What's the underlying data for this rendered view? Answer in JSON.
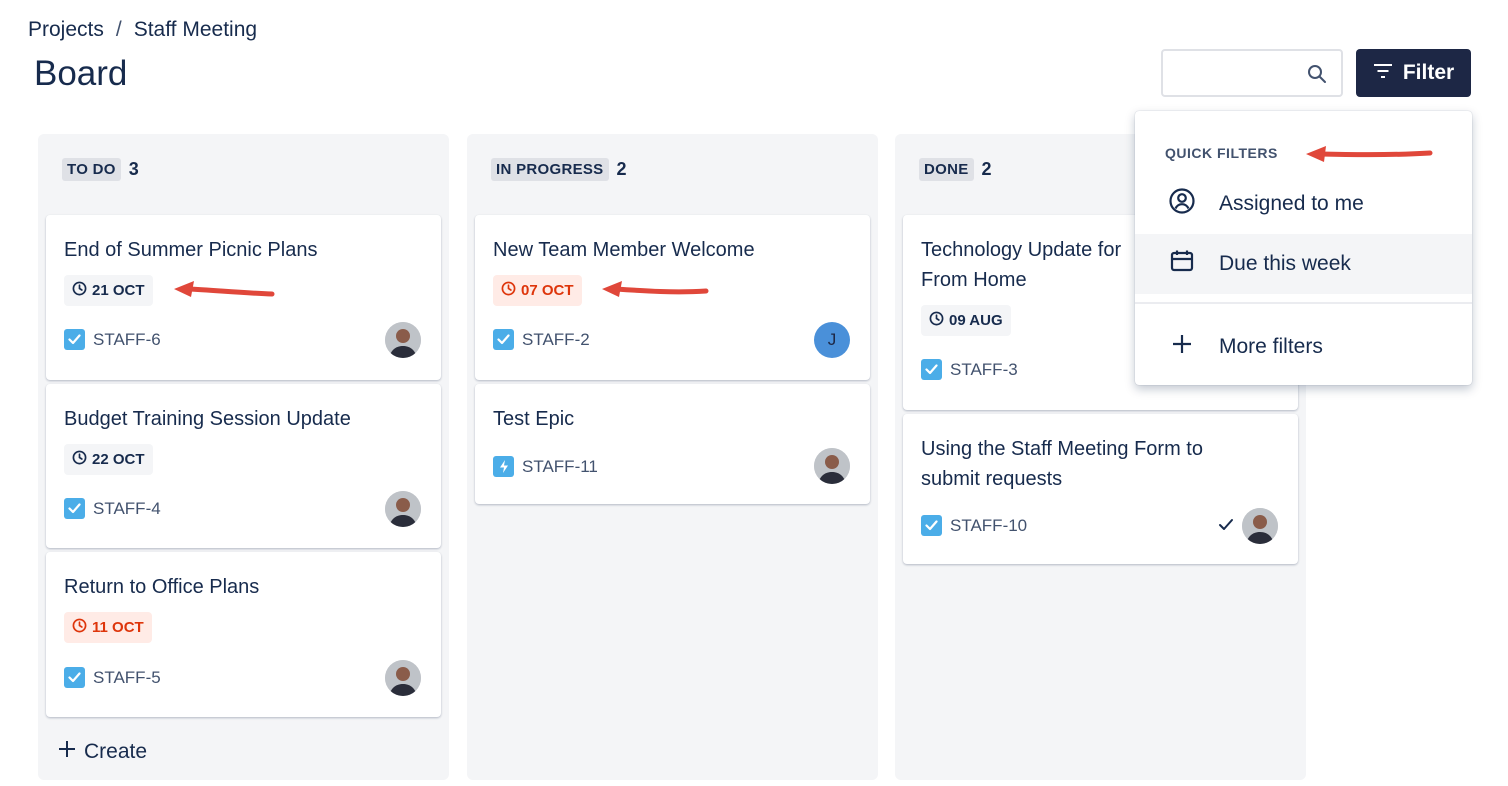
{
  "breadcrumb": {
    "items": [
      "Projects",
      "Staff Meeting"
    ],
    "separator": "/"
  },
  "page_title": "Board",
  "search": {
    "value": "",
    "placeholder": ""
  },
  "filter_button": {
    "label": "Filter"
  },
  "columns": [
    {
      "title": "TO DO",
      "count": "3",
      "create_label": "Create",
      "cards": [
        {
          "title": "End of Summer Picnic Plans",
          "date": "21 OCT",
          "date_status": "normal",
          "key": "STAFF-6",
          "type": "task",
          "assignee": "photo"
        },
        {
          "title": "Budget Training Session Update",
          "date": "22 OCT",
          "date_status": "normal",
          "key": "STAFF-4",
          "type": "task",
          "assignee": "photo"
        },
        {
          "title": "Return to Office Plans",
          "date": "11 OCT",
          "date_status": "overdue",
          "key": "STAFF-5",
          "type": "task",
          "assignee": "photo"
        }
      ]
    },
    {
      "title": "IN PROGRESS",
      "count": "2",
      "cards": [
        {
          "title": "New Team Member Welcome",
          "date": "07 OCT",
          "date_status": "overdue",
          "key": "STAFF-2",
          "type": "task",
          "assignee": "J"
        },
        {
          "title": "Test Epic",
          "key": "STAFF-11",
          "type": "epic",
          "assignee": "photo"
        }
      ]
    },
    {
      "title": "DONE",
      "count": "2",
      "cards": [
        {
          "title_line1": "Technology Update for",
          "title_line2": "From Home",
          "date": "09 AUG",
          "date_status": "normal",
          "key": "STAFF-3",
          "type": "task"
        },
        {
          "title_line1": "Using the Staff Meeting Form to",
          "title_line2": "submit requests",
          "key": "STAFF-10",
          "type": "task",
          "assignee": "photo",
          "done_check": true
        }
      ]
    }
  ],
  "quick_filters": {
    "heading": "QUICK FILTERS",
    "items": [
      {
        "label": "Assigned to me",
        "icon": "person-circle-icon"
      },
      {
        "label": "Due this week",
        "icon": "calendar-icon",
        "highlighted": true
      }
    ],
    "more_label": "More filters"
  },
  "colors": {
    "accent_dark": "#1d2745",
    "overdue_text": "#de350b",
    "overdue_bg": "#ffebe6",
    "annotation_arrow": "#e0473a",
    "task_icon": "#4bade8"
  }
}
